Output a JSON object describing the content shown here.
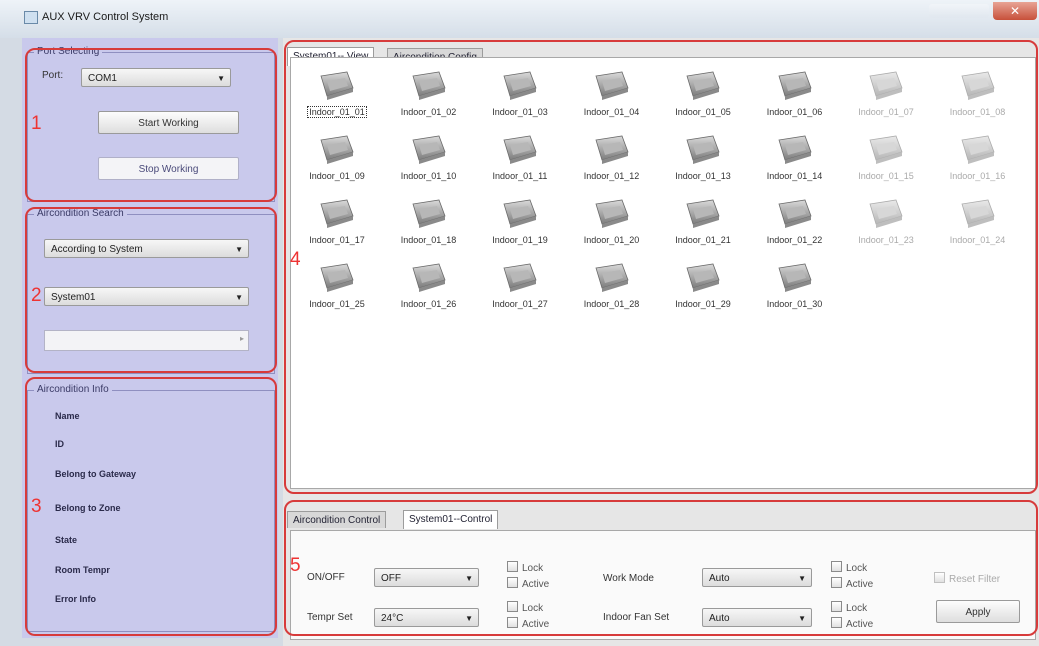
{
  "window": {
    "title": "AUX VRV Control System",
    "close_glyph": "✕"
  },
  "port_group": {
    "legend": "Port Selecting",
    "port_label": "Port:",
    "port_value": "COM1",
    "start_button": "Start Working",
    "stop_button": "Stop Working"
  },
  "search_group": {
    "legend": "Aircondition Search",
    "mode_value": "According to System",
    "system_value": "System01"
  },
  "info_group": {
    "legend": "Aircondition Info",
    "rows": [
      "Name",
      "ID",
      "Belong to Gateway",
      "Belong to Zone",
      "State",
      "Room Tempr",
      "Error Info"
    ]
  },
  "view_tabs": [
    "System01-- View",
    "Aircondition Config"
  ],
  "units": [
    "Indoor_01_01",
    "Indoor_01_02",
    "Indoor_01_03",
    "Indoor_01_04",
    "Indoor_01_05",
    "Indoor_01_06",
    "Indoor_01_07",
    "Indoor_01_08",
    "Indoor_01_09",
    "Indoor_01_10",
    "Indoor_01_11",
    "Indoor_01_12",
    "Indoor_01_13",
    "Indoor_01_14",
    "Indoor_01_15",
    "Indoor_01_16",
    "Indoor_01_17",
    "Indoor_01_18",
    "Indoor_01_19",
    "Indoor_01_20",
    "Indoor_01_21",
    "Indoor_01_22",
    "Indoor_01_23",
    "Indoor_01_24",
    "Indoor_01_25",
    "Indoor_01_26",
    "Indoor_01_27",
    "Indoor_01_28",
    "Indoor_01_29",
    "Indoor_01_30"
  ],
  "control_tabs": [
    "Aircondition Control",
    "System01--Control"
  ],
  "control": {
    "onoff_label": "ON/OFF",
    "onoff_value": "OFF",
    "tempr_label": "Tempr Set",
    "tempr_value": "24°C",
    "workmode_label": "Work Mode",
    "workmode_value": "Auto",
    "fan_label": "Indoor Fan Set",
    "fan_value": "Auto",
    "lock_label": "Lock",
    "active_label": "Active",
    "reset_button": "Reset Filter",
    "apply_button": "Apply"
  },
  "annotations": [
    "1",
    "2",
    "3",
    "4",
    "5"
  ],
  "colors": {
    "annotation": "#d73b3b",
    "sidebar": "#c9c9ec"
  }
}
